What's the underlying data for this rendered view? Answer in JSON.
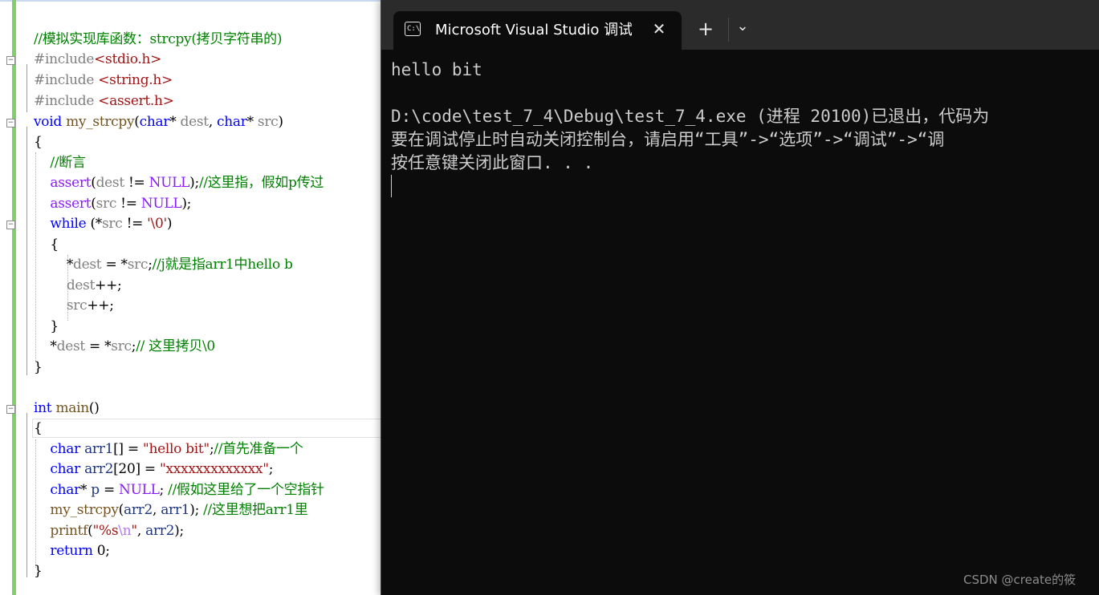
{
  "editor": {
    "lines": [
      {
        "parts": [
          {
            "t": "//模拟实现库函数：strcpy(拷贝字符串的)",
            "c": "com"
          }
        ]
      },
      {
        "parts": [
          {
            "t": "#include",
            "c": "pre"
          },
          {
            "t": "<stdio.h>",
            "c": "inc"
          }
        ]
      },
      {
        "parts": [
          {
            "t": "#include ",
            "c": "pre"
          },
          {
            "t": "<string.h>",
            "c": "inc"
          }
        ]
      },
      {
        "parts": [
          {
            "t": "#include ",
            "c": "pre"
          },
          {
            "t": "<assert.h>",
            "c": "inc"
          }
        ]
      },
      {
        "parts": [
          {
            "t": "void",
            "c": "kw"
          },
          {
            "t": " ",
            "c": ""
          },
          {
            "t": "my_strcpy",
            "c": "fn"
          },
          {
            "t": "(",
            "c": ""
          },
          {
            "t": "char",
            "c": "kw"
          },
          {
            "t": "* ",
            "c": ""
          },
          {
            "t": "dest",
            "c": "par"
          },
          {
            "t": ", ",
            "c": ""
          },
          {
            "t": "char",
            "c": "kw"
          },
          {
            "t": "* ",
            "c": ""
          },
          {
            "t": "src",
            "c": "par"
          },
          {
            "t": ")",
            "c": ""
          }
        ]
      },
      {
        "parts": [
          {
            "t": "{",
            "c": ""
          }
        ]
      },
      {
        "parts": [
          {
            "t": "    //断言",
            "c": "com"
          }
        ]
      },
      {
        "parts": [
          {
            "t": "    ",
            "c": ""
          },
          {
            "t": "assert",
            "c": "mac"
          },
          {
            "t": "(",
            "c": ""
          },
          {
            "t": "dest",
            "c": "par"
          },
          {
            "t": " != ",
            "c": ""
          },
          {
            "t": "NULL",
            "c": "mac"
          },
          {
            "t": ");",
            "c": ""
          },
          {
            "t": "//这里指，假如p传过",
            "c": "com"
          }
        ]
      },
      {
        "parts": [
          {
            "t": "    ",
            "c": ""
          },
          {
            "t": "assert",
            "c": "mac"
          },
          {
            "t": "(",
            "c": ""
          },
          {
            "t": "src",
            "c": "par"
          },
          {
            "t": " != ",
            "c": ""
          },
          {
            "t": "NULL",
            "c": "mac"
          },
          {
            "t": ");",
            "c": ""
          }
        ]
      },
      {
        "parts": [
          {
            "t": "    ",
            "c": ""
          },
          {
            "t": "while",
            "c": "kw"
          },
          {
            "t": " (*",
            "c": ""
          },
          {
            "t": "src",
            "c": "par"
          },
          {
            "t": " != ",
            "c": ""
          },
          {
            "t": "'\\0'",
            "c": "str"
          },
          {
            "t": ")",
            "c": ""
          }
        ]
      },
      {
        "parts": [
          {
            "t": "    {",
            "c": ""
          }
        ]
      },
      {
        "parts": [
          {
            "t": "        *",
            "c": ""
          },
          {
            "t": "dest",
            "c": "par"
          },
          {
            "t": " = *",
            "c": ""
          },
          {
            "t": "src",
            "c": "par"
          },
          {
            "t": ";",
            "c": ""
          },
          {
            "t": "//j就是指arr1中hello b",
            "c": "com"
          }
        ]
      },
      {
        "parts": [
          {
            "t": "        ",
            "c": ""
          },
          {
            "t": "dest",
            "c": "par"
          },
          {
            "t": "++;",
            "c": ""
          }
        ]
      },
      {
        "parts": [
          {
            "t": "        ",
            "c": ""
          },
          {
            "t": "src",
            "c": "par"
          },
          {
            "t": "++;",
            "c": ""
          }
        ]
      },
      {
        "parts": [
          {
            "t": "    }",
            "c": ""
          }
        ]
      },
      {
        "parts": [
          {
            "t": "    *",
            "c": ""
          },
          {
            "t": "dest",
            "c": "par"
          },
          {
            "t": " = *",
            "c": ""
          },
          {
            "t": "src",
            "c": "par"
          },
          {
            "t": ";",
            "c": ""
          },
          {
            "t": "// 这里拷贝\\0",
            "c": "com"
          }
        ]
      },
      {
        "parts": [
          {
            "t": "}",
            "c": ""
          }
        ]
      },
      {
        "parts": [
          {
            "t": "",
            "c": ""
          }
        ]
      },
      {
        "parts": [
          {
            "t": "int",
            "c": "kw"
          },
          {
            "t": " ",
            "c": ""
          },
          {
            "t": "main",
            "c": "fn"
          },
          {
            "t": "()",
            "c": ""
          }
        ]
      },
      {
        "parts": [
          {
            "t": "{",
            "c": ""
          }
        ]
      },
      {
        "parts": [
          {
            "t": "    ",
            "c": ""
          },
          {
            "t": "char",
            "c": "kw"
          },
          {
            "t": " ",
            "c": ""
          },
          {
            "t": "arr1",
            "c": "var"
          },
          {
            "t": "[] = ",
            "c": ""
          },
          {
            "t": "\"hello bit\"",
            "c": "str"
          },
          {
            "t": ";",
            "c": ""
          },
          {
            "t": "//首先准备一个",
            "c": "com"
          }
        ]
      },
      {
        "parts": [
          {
            "t": "    ",
            "c": ""
          },
          {
            "t": "char",
            "c": "kw"
          },
          {
            "t": " ",
            "c": ""
          },
          {
            "t": "arr2",
            "c": "var"
          },
          {
            "t": "[20] = ",
            "c": ""
          },
          {
            "t": "\"xxxxxxxxxxxxx\"",
            "c": "str"
          },
          {
            "t": ";",
            "c": ""
          }
        ]
      },
      {
        "parts": [
          {
            "t": "    ",
            "c": ""
          },
          {
            "t": "char",
            "c": "kw"
          },
          {
            "t": "* ",
            "c": ""
          },
          {
            "t": "p",
            "c": "var"
          },
          {
            "t": " = ",
            "c": ""
          },
          {
            "t": "NULL",
            "c": "mac"
          },
          {
            "t": "; ",
            "c": ""
          },
          {
            "t": "//假如这里给了一个空指针",
            "c": "com"
          }
        ]
      },
      {
        "parts": [
          {
            "t": "    ",
            "c": ""
          },
          {
            "t": "my_strcpy",
            "c": "fn"
          },
          {
            "t": "(",
            "c": ""
          },
          {
            "t": "arr2",
            "c": "var"
          },
          {
            "t": ", ",
            "c": ""
          },
          {
            "t": "arr1",
            "c": "var"
          },
          {
            "t": "); ",
            "c": ""
          },
          {
            "t": "//这里想把arr1里",
            "c": "com"
          }
        ]
      },
      {
        "parts": [
          {
            "t": "    ",
            "c": ""
          },
          {
            "t": "printf",
            "c": "fn"
          },
          {
            "t": "(",
            "c": ""
          },
          {
            "t": "\"%s",
            "c": "str"
          },
          {
            "t": "\\n",
            "c": "esc"
          },
          {
            "t": "\"",
            "c": "str"
          },
          {
            "t": ", ",
            "c": ""
          },
          {
            "t": "arr2",
            "c": "var"
          },
          {
            "t": ");",
            "c": ""
          }
        ]
      },
      {
        "parts": [
          {
            "t": "    ",
            "c": ""
          },
          {
            "t": "return",
            "c": "kw"
          },
          {
            "t": " 0;",
            "c": ""
          }
        ]
      },
      {
        "parts": [
          {
            "t": "}",
            "c": ""
          }
        ]
      }
    ]
  },
  "terminal": {
    "tab_title": "Microsoft Visual Studio 调试控",
    "icon_label": "C:\\",
    "close_glyph": "✕",
    "new_tab_glyph": "+",
    "dropdown_glyph": "⌄",
    "output": [
      "hello bit",
      "",
      "D:\\code\\test_7_4\\Debug\\test_7_4.exe (进程 20100)已退出，代码为",
      "要在调试停止时自动关闭控制台，请启用“工具”->“选项”->“调试”->“调",
      "按任意键关闭此窗口. . ."
    ]
  },
  "watermark": "CSDN @create的筱"
}
